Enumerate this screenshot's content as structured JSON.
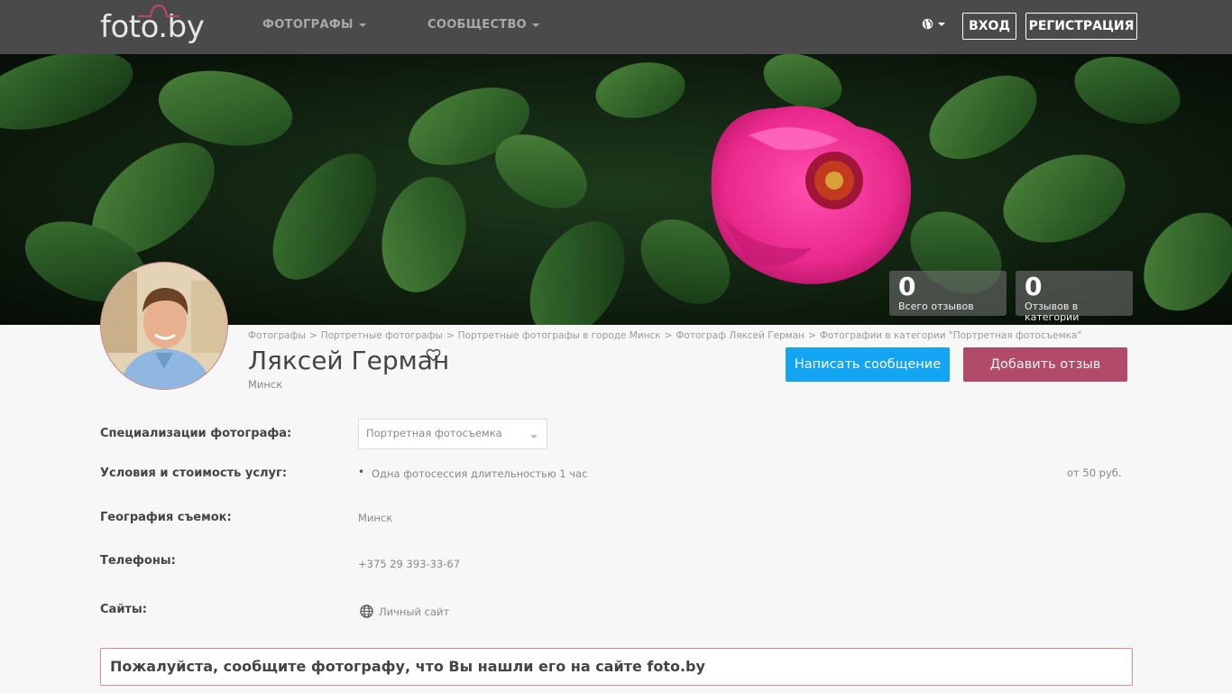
{
  "header": {
    "logo": "foto.by",
    "nav": [
      {
        "label": "ФОТОГРАФЫ"
      },
      {
        "label": "СООБЩЕСТВО"
      }
    ],
    "language_icon": "globe-icon",
    "login_label": "ВХОД",
    "register_label": "РЕГИСТРАЦИЯ"
  },
  "stats": [
    {
      "value": "0",
      "label": "Всего отзывов"
    },
    {
      "value": "0",
      "label": "Отзывов в категории"
    }
  ],
  "breadcrumb": [
    "Фотографы",
    "Портретные фотографы",
    "Портретные фотографы в городе Минск",
    "Фотограф Ляксей Герман",
    "Фотографии в категории \"Портретная фотосъемка\""
  ],
  "profile": {
    "name": "Ляксей Герман",
    "city": "Минск",
    "message_button": "Написать сообщение",
    "review_button": "Добавить отзыв"
  },
  "info": {
    "specialization_label": "Специализации фотографа:",
    "specialization_value": "Портретная фотосъемка",
    "services_label": "Условия и стоимость услуг:",
    "services": [
      {
        "name": "Одна фотосессия длительностью 1 час",
        "price": "от 50 руб."
      }
    ],
    "geography_label": "География съемок:",
    "geography_value": "Минск",
    "phones_label": "Телефоны:",
    "phone_value": "+375 29 393-33-67",
    "sites_label": "Сайты:",
    "site_value": "Личный сайт"
  },
  "notice": "Пожалуйста, сообщите фотографу, что Вы нашли его на сайте foto.by",
  "colors": {
    "topbar": "#4a4a4a",
    "message_button": "#14a5f2",
    "review_button": "#b24a6a",
    "notice_border": "#e8888f"
  }
}
